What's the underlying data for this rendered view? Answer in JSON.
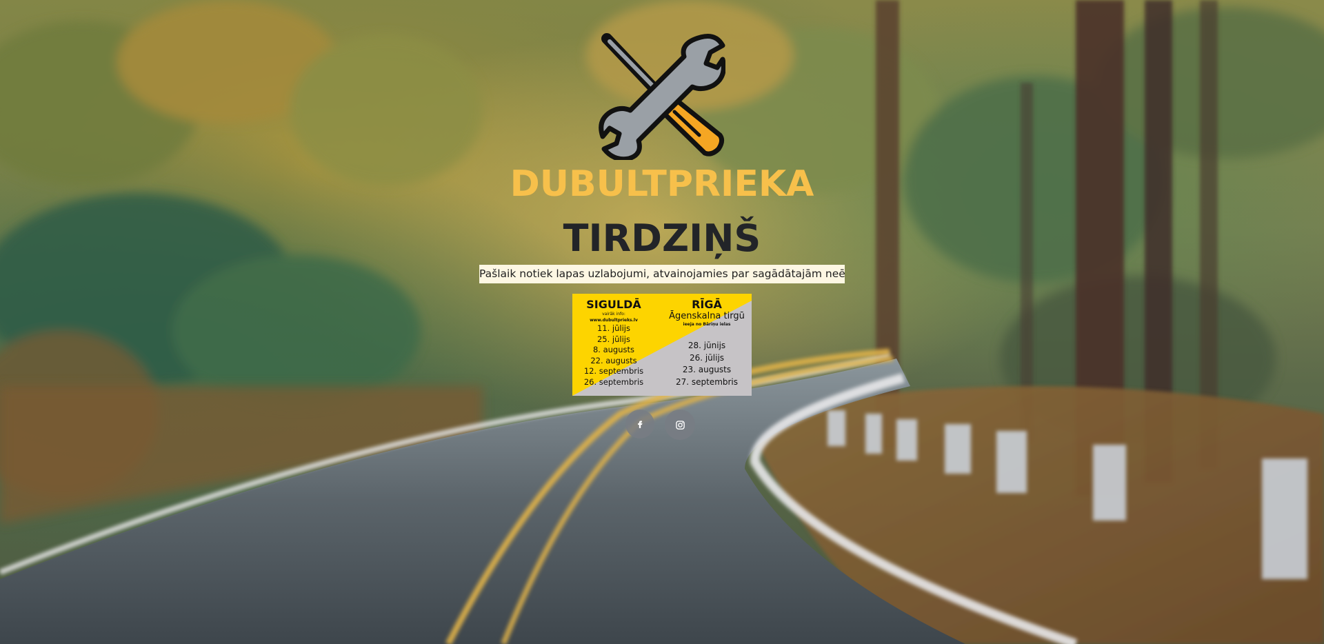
{
  "brand": {
    "title": "DUBULTPRIEKA",
    "subtitle": "TIRDZIŅŠ",
    "logo_icon": "wrench-screwdriver-icon",
    "title_color": "#f7c04b",
    "subtitle_color": "#222428"
  },
  "notice": {
    "text": "Pašlaik notiek lapas uzlabojumi, atvainojamies par sagādātajām neērtībām.",
    "background": "#fdf7e3"
  },
  "schedule": {
    "colors": {
      "yellow": "#fdd400",
      "grey": "#c6c3c6"
    },
    "sigulda": {
      "city": "SIGULDĀ",
      "info_line": "vairāk info:",
      "url": "www.dubultprieks.lv",
      "dates": [
        "11. jūlijs",
        "25. jūlijs",
        "8. augusts",
        "22. augusts",
        "12. septembris",
        "26. septembris"
      ]
    },
    "riga": {
      "city": "RĪGĀ",
      "place": "Āgenskalna tirgū",
      "entrance": "ieeja no Bāriņu ielas",
      "dates": [
        "28. jūnijs",
        "26. jūlijs",
        "23. augusts",
        "27. septembris"
      ]
    }
  },
  "socials": [
    {
      "name": "facebook",
      "icon": "facebook-icon"
    },
    {
      "name": "instagram",
      "icon": "instagram-icon"
    }
  ]
}
